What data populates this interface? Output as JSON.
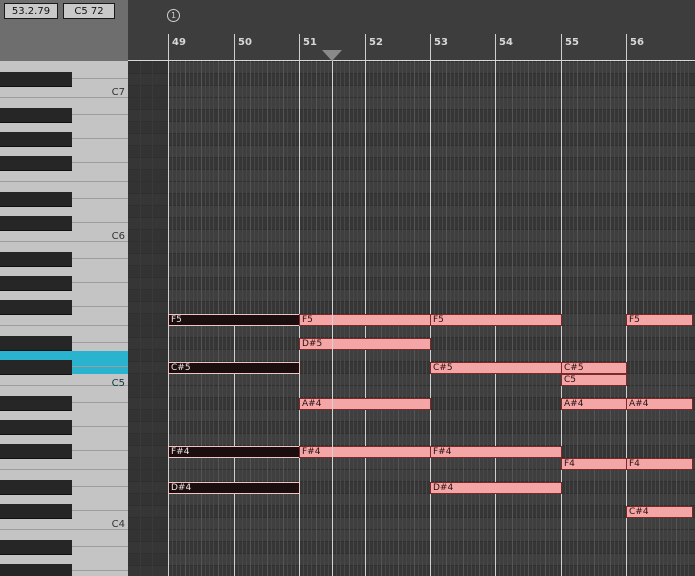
{
  "position_readout": "53.2.79",
  "note_readout": "C5  72",
  "marker": "1",
  "bars": [
    "49",
    "50",
    "51",
    "52",
    "53",
    "54",
    "55",
    "56"
  ],
  "octave_labels": [
    "C7",
    "C6",
    "C5",
    "C4"
  ],
  "notes": [
    {
      "label": "F5",
      "style": "selected"
    },
    {
      "label": "F5",
      "style": "pink"
    },
    {
      "label": "F5",
      "style": "pink"
    },
    {
      "label": "F5",
      "style": "pink"
    },
    {
      "label": "D#5",
      "style": "pink"
    },
    {
      "label": "C#5",
      "style": "selected"
    },
    {
      "label": "C#5",
      "style": "pink"
    },
    {
      "label": "C#5",
      "style": "pink"
    },
    {
      "label": "C5",
      "style": "pink"
    },
    {
      "label": "A#4",
      "style": "pink"
    },
    {
      "label": "A#4",
      "style": "pink"
    },
    {
      "label": "A#4",
      "style": "pink"
    },
    {
      "label": "F#4",
      "style": "selected"
    },
    {
      "label": "F#4",
      "style": "pink"
    },
    {
      "label": "F#4",
      "style": "pink"
    },
    {
      "label": "F4",
      "style": "pink"
    },
    {
      "label": "F4",
      "style": "pink"
    },
    {
      "label": "D#4",
      "style": "selected"
    },
    {
      "label": "D#4",
      "style": "pink"
    },
    {
      "label": "C#4",
      "style": "pink"
    }
  ],
  "colors": {
    "note_fill": "#f4a5a5",
    "selected_note_fill": "#1a0e0e",
    "key_highlight": "#2ab3cf"
  }
}
